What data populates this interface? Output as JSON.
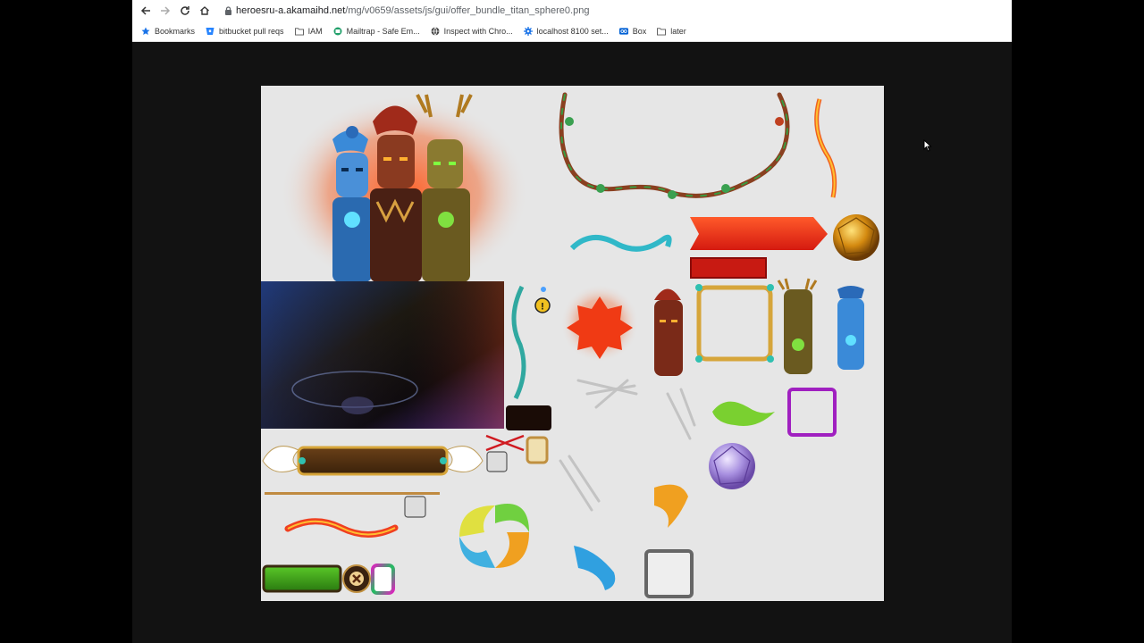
{
  "browser": {
    "url_host": "heroesru-a.akamaihd.net",
    "url_path": "/mg/v0659/assets/js/gui/offer_bundle_titan_sphere0.png",
    "bookmarks": [
      {
        "label": "Bookmarks",
        "icon": "star-icon"
      },
      {
        "label": "bitbucket pull reqs",
        "icon": "bitbucket-icon"
      },
      {
        "label": "IAM",
        "icon": "folder-icon"
      },
      {
        "label": "Mailtrap - Safe Em...",
        "icon": "mailtrap-icon"
      },
      {
        "label": "Inspect with Chro...",
        "icon": "globe-icon"
      },
      {
        "label": "localhost 8100 set...",
        "icon": "gear-icon"
      },
      {
        "label": "Box",
        "icon": "box-icon"
      },
      {
        "label": "later",
        "icon": "folder-icon"
      }
    ]
  },
  "sheet": {
    "alert_badge": "!",
    "colors": {
      "background": "#e6e6e6",
      "fire": "#e8371d",
      "gold": "#d6a53a",
      "purple": "#a020c0",
      "green": "#3ea020"
    }
  }
}
